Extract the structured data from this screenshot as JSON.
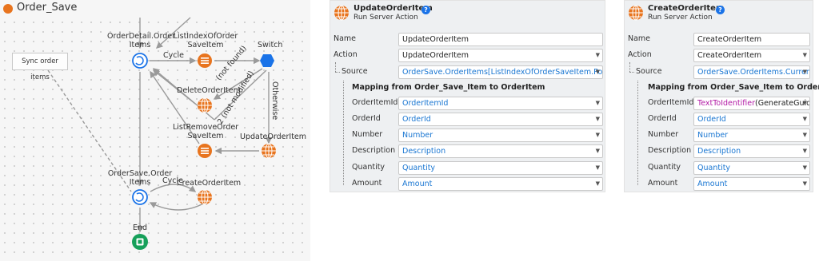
{
  "flow": {
    "title": "Order_Save",
    "comment": "Sync order items",
    "labels": {
      "cycle1_node": "OrderDetail.Order Items",
      "list_index": "ListIndexOfOrder SaveItem",
      "switch": "Switch",
      "cycle1": "Cycle",
      "delete": "DeleteOrderItem",
      "not_found": "(not found)",
      "not_modified": "2 (not modified)",
      "otherwise": "Otherwise",
      "list_remove": "ListRemoveOrder SaveItem",
      "update": "UpdateOrderItem",
      "cycle2_node": "OrderSave.Order Items",
      "cycle2": "Cycle",
      "create": "CreateOrderItem",
      "end": "End"
    }
  },
  "update_panel": {
    "name": "UpdateOrderItem",
    "subtitle": "Run Server Action",
    "name_label": "Name",
    "name_value": "UpdateOrderItem",
    "action_label": "Action",
    "action_value": "UpdateOrderItem",
    "source_label": "Source",
    "source_value": "OrderSave.OrderItems[ListIndexOfOrderSaveItem.Position]",
    "mapping_title": "Mapping from Order_Save_Item to OrderItem",
    "mappings": [
      {
        "key": "OrderItemId",
        "value": "OrderItemId"
      },
      {
        "key": "OrderId",
        "value": "OrderId"
      },
      {
        "key": "Number",
        "value": "Number"
      },
      {
        "key": "Description",
        "value": "Description"
      },
      {
        "key": "Quantity",
        "value": "Quantity"
      },
      {
        "key": "Amount",
        "value": "Amount"
      }
    ]
  },
  "create_panel": {
    "name": "CreateOrderItem",
    "subtitle": "Run Server Action",
    "name_label": "Name",
    "name_value": "CreateOrderItem",
    "action_label": "Action",
    "action_value": "CreateOrderItem",
    "source_label": "Source",
    "source_value": "OrderSave.OrderItems.Current",
    "mapping_title": "Mapping from Order_Save_Item to OrderItem",
    "mappings": [
      {
        "key": "OrderItemId",
        "fn": "TextToIdentifier",
        "arg": "(GenerateGuid())"
      },
      {
        "key": "OrderId",
        "value": "OrderId"
      },
      {
        "key": "Number",
        "value": "Number"
      },
      {
        "key": "Description",
        "value": "Description"
      },
      {
        "key": "Quantity",
        "value": "Quantity"
      },
      {
        "key": "Amount",
        "value": "Amount"
      }
    ]
  },
  "colors": {
    "accent_orange": "#e8741e",
    "link_blue": "#1976d2",
    "switch_blue": "#1a73e8",
    "end_green": "#16a05a",
    "function_magenta": "#b21aa5"
  },
  "icons": {
    "action": "server-action-icon",
    "help": "help-icon",
    "dropdown": "chevron-down-icon",
    "cycle": "cycle-icon",
    "switch": "switch-icon",
    "list": "list-action-icon",
    "end": "end-icon"
  }
}
